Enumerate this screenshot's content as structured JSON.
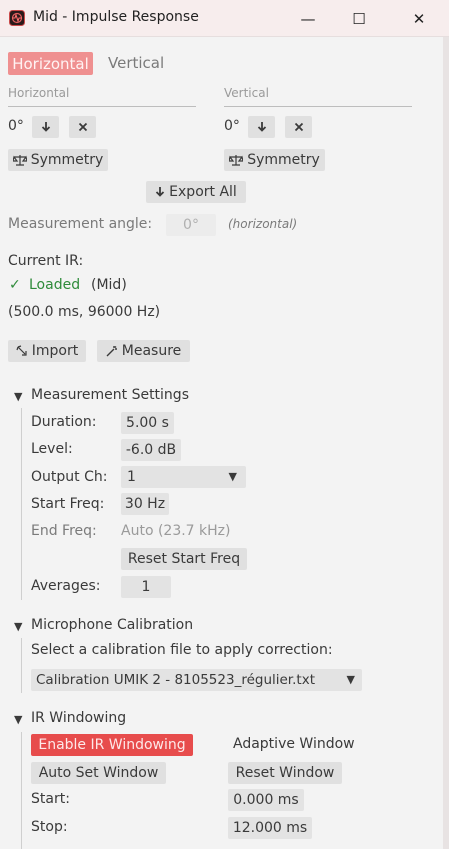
{
  "window": {
    "title": "Mid - Impulse Response",
    "minimize_glyph": "—",
    "maximize_glyph": "☐",
    "close_glyph": "✕"
  },
  "tabs": [
    {
      "label": "Horizontal",
      "active": true
    },
    {
      "label": "Vertical",
      "active": false
    }
  ],
  "horizontal": {
    "header": "Horizontal",
    "angle": "0°",
    "symmetry_label": "Symmetry"
  },
  "vertical": {
    "header": "Vertical",
    "angle": "0°",
    "symmetry_label": "Symmetry"
  },
  "export_all_label": "Export All",
  "measurement_angle": {
    "label": "Measurement angle:",
    "value": "0°",
    "note": "(horizontal)"
  },
  "current_ir": {
    "label": "Current IR:",
    "status_check": "✓",
    "status": "Loaded",
    "channel": "(Mid)",
    "details": "(500.0 ms, 96000 Hz)"
  },
  "actions": {
    "import_label": "Import",
    "measure_label": "Measure"
  },
  "measurement_settings": {
    "title": "Measurement Settings",
    "duration_label": "Duration:",
    "duration_value": "5.00 s",
    "level_label": "Level:",
    "level_value": "-6.0 dB",
    "output_label": "Output Ch:",
    "output_value": "1",
    "start_freq_label": "Start Freq:",
    "start_freq_value": "30 Hz",
    "end_freq_label": "End Freq:",
    "end_freq_value": "Auto (23.7 kHz)",
    "reset_start_label": "Reset Start Freq",
    "averages_label": "Averages:",
    "averages_value": "1"
  },
  "mic_calibration": {
    "title": "Microphone Calibration",
    "description": "Select a calibration file to apply correction:",
    "selected_file": "Calibration UMIK 2 - 8105523_régulier.txt"
  },
  "ir_windowing": {
    "title": "IR Windowing",
    "enable_label": "Enable IR Windowing",
    "adaptive_label": "Adaptive Window",
    "auto_set_label": "Auto Set Window",
    "reset_label": "Reset Window",
    "start_label": "Start:",
    "start_value": "0.000 ms",
    "stop_label": "Stop:",
    "stop_value": "12.000 ms"
  },
  "colors": {
    "accent_red": "#e74c4c",
    "tab_active": "#ef9090",
    "loaded_green": "#2e8b3a"
  },
  "icons": [
    "app-logo-icon",
    "download-icon",
    "close-icon",
    "balance-scale-icon",
    "import-icon",
    "wand-icon",
    "triangle-down-icon"
  ]
}
